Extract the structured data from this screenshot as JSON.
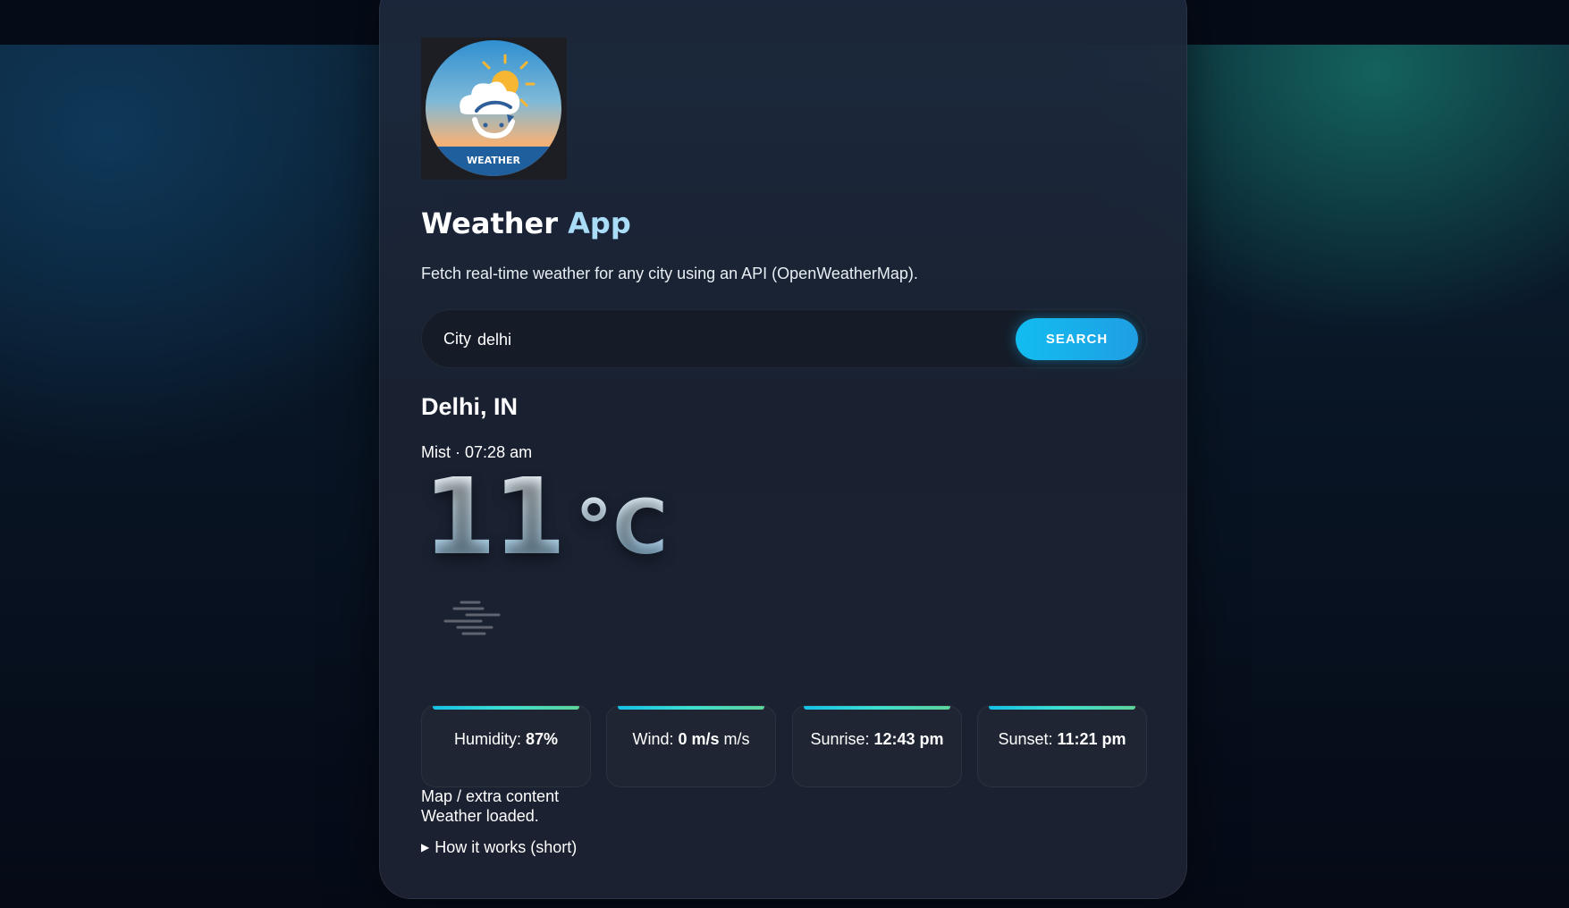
{
  "app": {
    "logo_text": "WEATHER",
    "title_part1": "Weather",
    "title_part2": "App",
    "subtitle": "Fetch real-time weather for any city using an API (OpenWeatherMap)."
  },
  "search": {
    "label": "City",
    "value": "delhi",
    "button_label": "SEARCH"
  },
  "weather": {
    "location": "Delhi, IN",
    "condition": "Mist",
    "separator": "·",
    "time": "07:28 am",
    "temperature": "11",
    "unit": "°C",
    "icon": "mist-icon"
  },
  "stats": {
    "humidity": {
      "label": "Humidity:",
      "value": "87%",
      "suffix": ""
    },
    "wind": {
      "label": "Wind:",
      "value": "0 m/s",
      "suffix": "m/s"
    },
    "sunrise": {
      "label": "Sunrise:",
      "value": "12:43 pm"
    },
    "sunset": {
      "label": "Sunset:",
      "value": "11:21 pm"
    }
  },
  "extra": {
    "map_text": "Map / extra content",
    "status_text": "Weather loaded."
  },
  "details": {
    "summary": "How it works (short)"
  },
  "colors": {
    "accent": "#12bdf0",
    "title_highlight": "#a9dcf7",
    "card_bg": "#1b2130",
    "stat_bar_start": "#13c2e8",
    "stat_bar_end": "#5dd39a"
  }
}
